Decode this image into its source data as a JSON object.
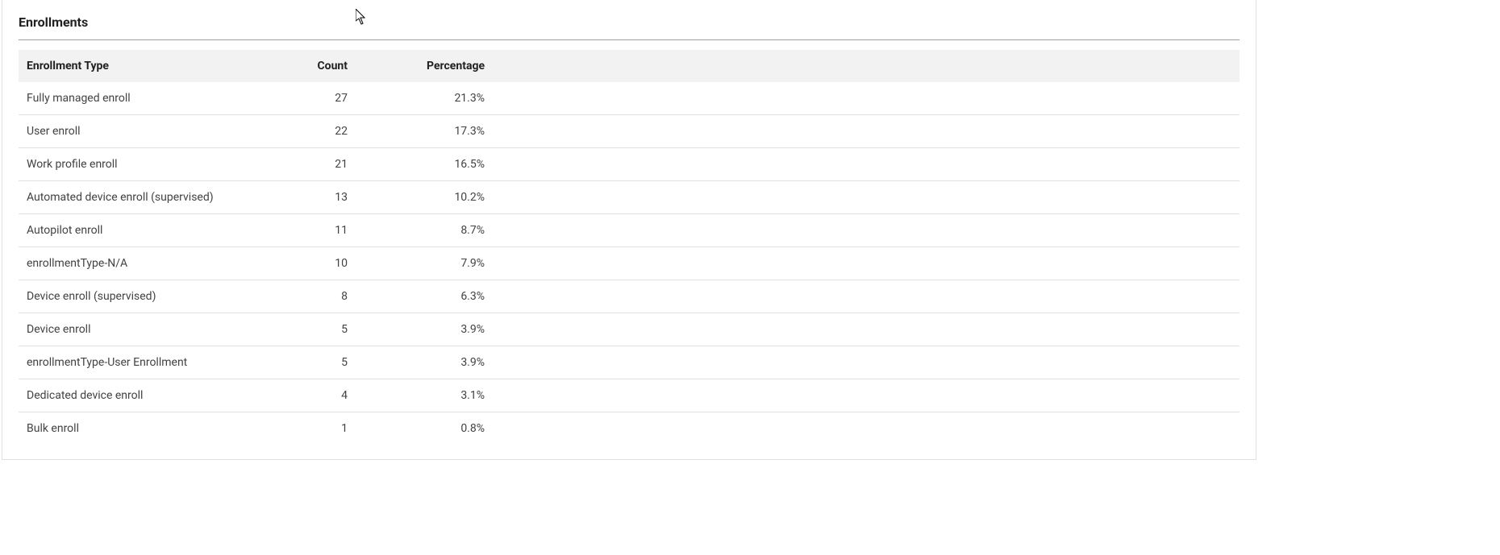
{
  "panel": {
    "title": "Enrollments"
  },
  "table": {
    "headers": {
      "type": "Enrollment Type",
      "count": "Count",
      "percentage": "Percentage"
    },
    "rows": [
      {
        "type": "Fully managed enroll",
        "count": "27",
        "percentage": "21.3%"
      },
      {
        "type": "User enroll",
        "count": "22",
        "percentage": "17.3%"
      },
      {
        "type": "Work profile enroll",
        "count": "21",
        "percentage": "16.5%"
      },
      {
        "type": "Automated device enroll (supervised)",
        "count": "13",
        "percentage": "10.2%"
      },
      {
        "type": "Autopilot enroll",
        "count": "11",
        "percentage": "8.7%"
      },
      {
        "type": "enrollmentType-N/A",
        "count": "10",
        "percentage": "7.9%"
      },
      {
        "type": "Device enroll (supervised)",
        "count": "8",
        "percentage": "6.3%"
      },
      {
        "type": "Device enroll",
        "count": "5",
        "percentage": "3.9%"
      },
      {
        "type": "enrollmentType-User Enrollment",
        "count": "5",
        "percentage": "3.9%"
      },
      {
        "type": "Dedicated device enroll",
        "count": "4",
        "percentage": "3.1%"
      },
      {
        "type": "Bulk enroll",
        "count": "1",
        "percentage": "0.8%"
      }
    ]
  }
}
